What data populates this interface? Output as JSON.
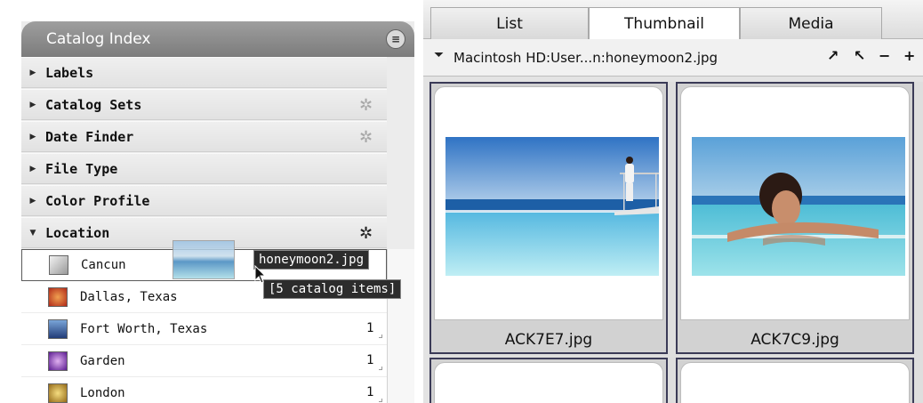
{
  "catalog_index": {
    "title": "Catalog Index",
    "menu_icon": "list-menu-icon",
    "categories": [
      {
        "label": "Labels",
        "expanded": false,
        "gear": false
      },
      {
        "label": "Catalog Sets",
        "expanded": false,
        "gear": true
      },
      {
        "label": "Date Finder",
        "expanded": false,
        "gear": true
      },
      {
        "label": "File Type",
        "expanded": false,
        "gear": false
      },
      {
        "label": "Color Profile",
        "expanded": false,
        "gear": false
      },
      {
        "label": "Location",
        "expanded": true,
        "gear": true
      }
    ],
    "locations": [
      {
        "label": "Cancun",
        "count": "",
        "swatch": "#c9c9c9"
      },
      {
        "label": "Dallas, Texas",
        "count": "",
        "swatch": "#c8402c"
      },
      {
        "label": "Fort Worth, Texas",
        "count": "1",
        "swatch": "#3b64a6"
      },
      {
        "label": "Garden",
        "count": "1",
        "swatch": "#7a3ab0"
      },
      {
        "label": "London",
        "count": "1",
        "swatch": "#c9a23c"
      }
    ]
  },
  "drag": {
    "filename": "honeymoon2.jpg",
    "items_label": "[5 catalog items]"
  },
  "viewer": {
    "tabs": [
      {
        "label": "List",
        "active": false
      },
      {
        "label": "Thumbnail",
        "active": true
      },
      {
        "label": "Media",
        "active": false
      }
    ],
    "path": "Macintosh HD:User...n:honeymoon2.jpg",
    "path_controls": [
      "↗",
      "↖",
      "−",
      "+"
    ],
    "thumbnails": [
      {
        "label": "ACK7E7.jpg"
      },
      {
        "label": "ACK7C9.jpg"
      }
    ]
  },
  "colors": {
    "header_gray": "#8a8a8a",
    "cell_border": "#3b3b57",
    "water_blue": "#3f86bd"
  }
}
